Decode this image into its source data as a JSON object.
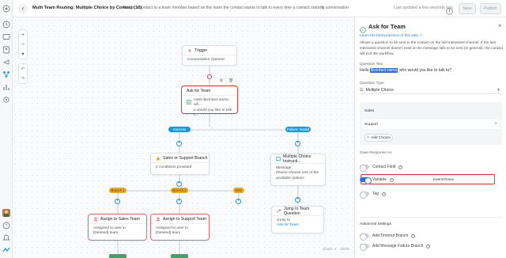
{
  "header": {
    "title": "Multi Team Routing: Multiple Choice by Contact (10)",
    "description": "Assign a contact to a team member based on the team the contact wants to talk to every time a contact starts a conversation",
    "saved_status": "Last updated a few seconds ago",
    "save_label": "Save",
    "publish_label": "Publish"
  },
  "canvas": {
    "zoom_level": "Zoom: 1 · 100%",
    "nodes": {
      "trigger": {
        "title": "Trigger",
        "body": "Conversation Opened"
      },
      "ask": {
        "title": "Ask for Team",
        "body_prefix": "Hello ",
        "body_var": "$contact.name",
        "body_suffix": ", wh...",
        "body_line2": "o would you like to talk t..."
      },
      "branch": {
        "title": "Sales or Support Branch",
        "body": "2 conditions provided"
      },
      "multi": {
        "title": "Multiple Choice Instructi...",
        "body_label": "Message",
        "body_text": "Please choose one of the available options"
      },
      "jump": {
        "title": "Jump to Team Question",
        "body_label": "Jump to",
        "body_link": "Ask for Team"
      },
      "assign_sales": {
        "title": "Assign to Sales Team",
        "body": "Assigned to user in [Deleted] team"
      },
      "assign_support": {
        "title": "Assign to Support Team",
        "body": "Assigned to user in [Deleted] team"
      }
    },
    "pills": {
      "success": "Success",
      "failure": "Failure: Invalid",
      "branch1": "Branch 1",
      "branch2": "Branch 2",
      "else": "Else"
    }
  },
  "panel": {
    "title": "Ask for Team",
    "learn_link": "Learn the best practices of this step",
    "description": "Allows a question to be sent to the contact on the last interacted channel. If the last interacted channel doesn't exist or the message fails to be sent (in general), the contact will exit the workflow.",
    "question_text_label": "Question Text",
    "question_prefix": "Hello ",
    "question_var": "$contact.name",
    "question_suffix": " who would you like to talk to?",
    "question_type_label": "Question Type",
    "question_type_value": "Multiple Choice",
    "choices": [
      "Sales",
      "Support"
    ],
    "add_choice_label": "Add Choice",
    "save_response_label": "Save Response As",
    "contact_field_label": "Contact Field",
    "variable_label": "Variable",
    "variable_value": "teamChoice",
    "tag_label": "Tag",
    "advanced_label": "Advanced Settings",
    "timeout_label": "Add Timeout Branch",
    "failure_label": "Add Message Failure Branch"
  },
  "colors": {
    "accent": "#1c9ad6",
    "branch": "#f2a81d",
    "highlight_border": "#d93a3a",
    "toggle_on": "#2f6fe0"
  }
}
